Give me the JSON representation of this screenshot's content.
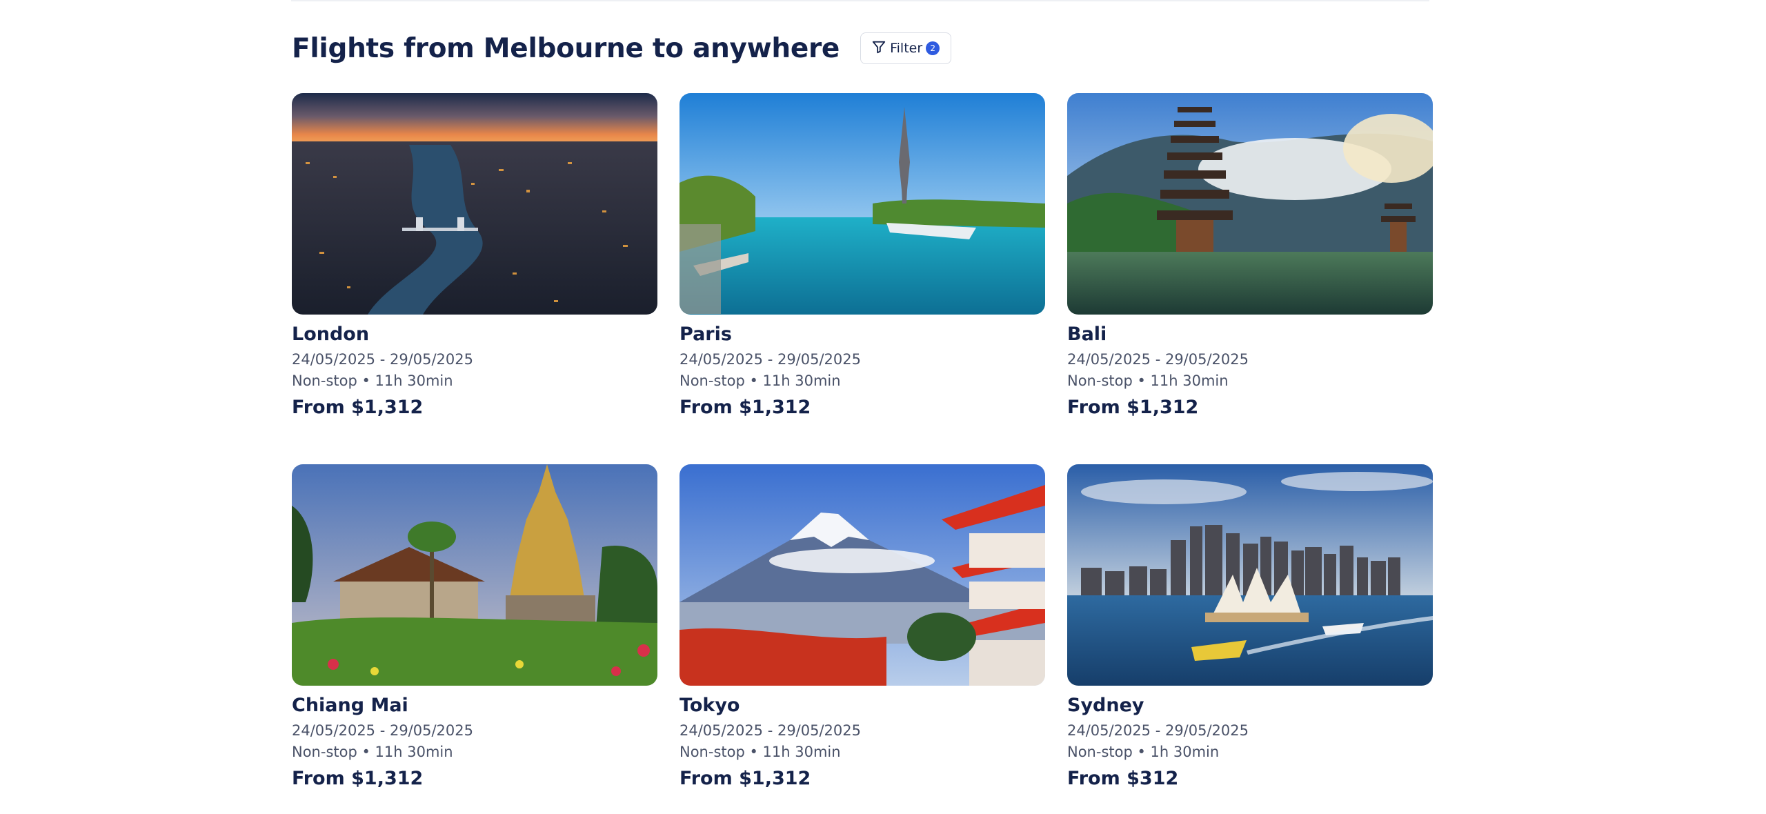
{
  "header": {
    "title": "Flights from Melbourne to anywhere",
    "filter_label": "Filter",
    "filter_count": "2"
  },
  "destinations": [
    {
      "city": "London",
      "dates": "24/05/2025 - 29/05/2025",
      "meta": "Non-stop • 11h 30min",
      "price": "From $1,312",
      "scene": "london-skyline-at-dusk"
    },
    {
      "city": "Paris",
      "dates": "24/05/2025 - 29/05/2025",
      "meta": "Non-stop • 11h 30min",
      "price": "From $1,312",
      "scene": "eiffel-tower-and-seine"
    },
    {
      "city": "Bali",
      "dates": "24/05/2025 - 29/05/2025",
      "meta": "Non-stop • 11h 30min",
      "price": "From $1,312",
      "scene": "lake-temple-pagoda"
    },
    {
      "city": "Chiang Mai",
      "dates": "24/05/2025 - 29/05/2025",
      "meta": "Non-stop • 11h 30min",
      "price": "From $1,312",
      "scene": "golden-temple-garden"
    },
    {
      "city": "Tokyo",
      "dates": "24/05/2025 - 29/05/2025",
      "meta": "Non-stop • 11h 30min",
      "price": "From $1,312",
      "scene": "mount-fuji-pagoda"
    },
    {
      "city": "Sydney",
      "dates": "24/05/2025 - 29/05/2025",
      "meta": "Non-stop • 1h 30min",
      "price": "From $312",
      "scene": "opera-house-harbour"
    }
  ],
  "colors": {
    "brand_text": "#14224a",
    "secondary_text": "#4a5268",
    "badge": "#2f5be0",
    "border": "#d9dde5"
  }
}
